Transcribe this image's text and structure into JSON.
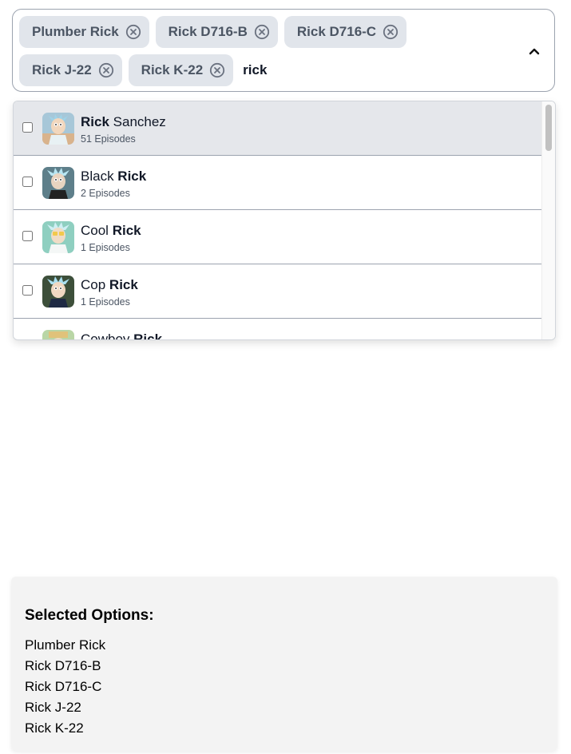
{
  "multiselect": {
    "chips": [
      {
        "label": "Plumber Rick"
      },
      {
        "label": "Rick D716-B"
      },
      {
        "label": "Rick D716-C"
      },
      {
        "label": "Rick J-22"
      },
      {
        "label": "Rick K-22"
      }
    ],
    "search_value": "rick",
    "toggle_icon": "chevron-up-icon"
  },
  "dropdown": {
    "options": [
      {
        "name_before": "",
        "name_match": "Rick",
        "name_after": " Sanchez",
        "episodes": "51 Episodes",
        "checked": false,
        "highlighted": true
      },
      {
        "name_before": "Black ",
        "name_match": "Rick",
        "name_after": "",
        "episodes": "2 Episodes",
        "checked": false,
        "highlighted": false
      },
      {
        "name_before": "Cool ",
        "name_match": "Rick",
        "name_after": "",
        "episodes": "1 Episodes",
        "checked": false,
        "highlighted": false
      },
      {
        "name_before": "Cop ",
        "name_match": "Rick",
        "name_after": "",
        "episodes": "1 Episodes",
        "checked": false,
        "highlighted": false
      },
      {
        "name_before": "Cowboy ",
        "name_match": "Rick",
        "name_after": "",
        "episodes": "",
        "checked": false,
        "highlighted": false
      }
    ]
  },
  "selected_panel": {
    "title": "Selected Options:",
    "items": [
      "Plumber Rick",
      "Rick D716-B",
      "Rick D716-C",
      "Rick J-22",
      "Rick K-22"
    ]
  },
  "colors": {
    "chip_bg": "#e1e5eb",
    "chip_text": "#4b5563",
    "highlight_row": "#e5e7eb",
    "panel_bg": "#f3f3f3"
  }
}
